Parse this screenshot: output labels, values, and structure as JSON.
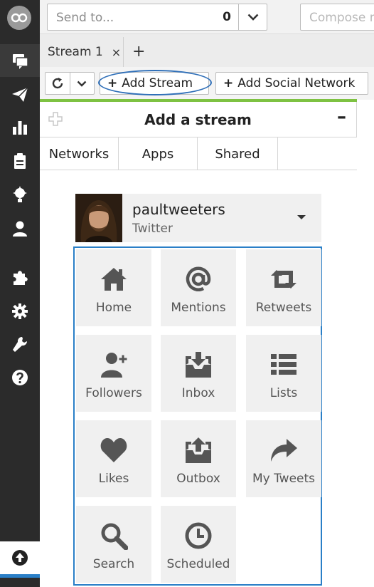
{
  "sidebar": {
    "logo": "owl-logo-icon",
    "items": [
      {
        "name": "streams-icon",
        "active": true
      },
      {
        "name": "publisher-icon"
      },
      {
        "name": "analytics-icon"
      },
      {
        "name": "assignments-icon"
      },
      {
        "name": "campaigns-icon"
      },
      {
        "name": "contacts-icon"
      },
      {
        "name": "apps-icon"
      },
      {
        "name": "settings-icon"
      },
      {
        "name": "tools-icon"
      },
      {
        "name": "help-icon"
      }
    ],
    "footer": "upload-icon"
  },
  "compose_bar": {
    "send_to_placeholder": "Send to...",
    "send_to_count": "0",
    "compose_placeholder": "Compose message..."
  },
  "tabs": [
    {
      "label": "Stream 1",
      "close": "×"
    }
  ],
  "tab_add": "+",
  "toolbar": {
    "add_stream_label": "Add Stream",
    "add_social_label": "Add Social Network",
    "plus": "+"
  },
  "panel": {
    "title": "Add a stream",
    "minimize": "–",
    "tabs": [
      "Networks",
      "Apps",
      "Shared"
    ],
    "account": {
      "name": "paultweeters",
      "network": "Twitter"
    },
    "stream_types": [
      {
        "label": "Home",
        "icon": "home-icon"
      },
      {
        "label": "Mentions",
        "icon": "at-icon"
      },
      {
        "label": "Retweets",
        "icon": "retweet-icon"
      },
      {
        "label": "Followers",
        "icon": "add-user-icon"
      },
      {
        "label": "Inbox",
        "icon": "inbox-icon"
      },
      {
        "label": "Lists",
        "icon": "list-icon"
      },
      {
        "label": "Likes",
        "icon": "heart-icon"
      },
      {
        "label": "Outbox",
        "icon": "outbox-icon"
      },
      {
        "label": "My Tweets",
        "icon": "share-arrow-icon"
      },
      {
        "label": "Search",
        "icon": "search-icon"
      },
      {
        "label": "Scheduled",
        "icon": "clock-icon"
      }
    ]
  },
  "colors": {
    "sidebar": "#2b2b2b",
    "accent_green": "#7ec242",
    "highlight_blue": "#2a7fc7",
    "tile_bg": "#f0f0f0",
    "icon_gray": "#555555"
  }
}
